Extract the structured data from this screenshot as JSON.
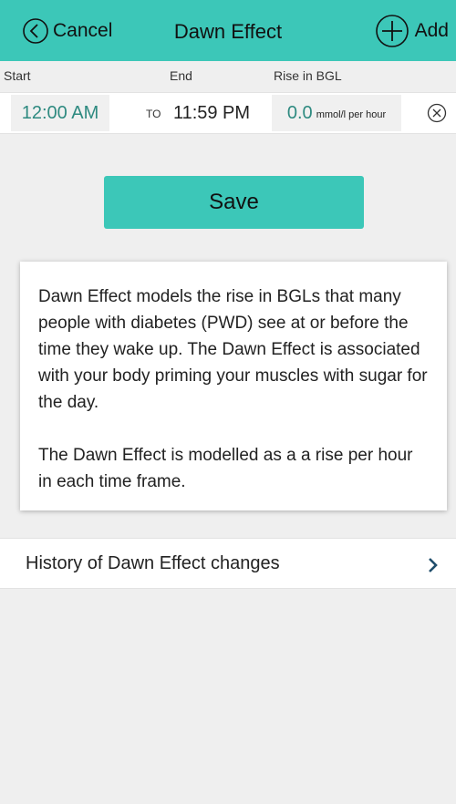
{
  "header": {
    "cancel_label": "Cancel",
    "title": "Dawn Effect",
    "add_label": "Add",
    "color": "#3cc7b8"
  },
  "columns": {
    "start": "Start",
    "end": "End",
    "rise": "Rise in BGL"
  },
  "range": {
    "start_time": "12:00 AM",
    "to_label": "TO",
    "end_time": "11:59 PM",
    "rise_value": "0.0",
    "rise_unit": "mmol/l per hour"
  },
  "save_label": "Save",
  "info": {
    "paragraph_1": "Dawn Effect models the rise in BGLs that many people with diabetes (PWD) see at or before the time they wake up. The Dawn Effect is associated with your body priming your muscles with sugar for the day.",
    "paragraph_2": "The Dawn Effect is modelled as a a rise per hour in each time frame."
  },
  "history": {
    "label": "History of Dawn Effect changes"
  },
  "colors": {
    "accent": "#3cc7b8",
    "value_text": "#2e8a80",
    "background": "#efefef"
  }
}
